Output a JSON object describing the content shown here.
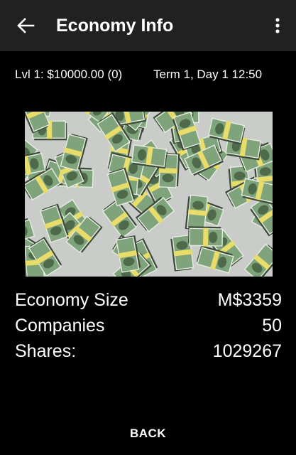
{
  "appbar": {
    "title": "Economy Info"
  },
  "status": {
    "level_balance": "Lvl 1: $10000.00 (0)",
    "term_time": "Term 1, Day 1  12:50"
  },
  "stats": [
    {
      "label": "Economy Size",
      "value": "M$3359"
    },
    {
      "label": "Companies",
      "value": "50"
    },
    {
      "label": "Shares:",
      "value": "1029267"
    }
  ],
  "footer": {
    "back_label": "BACK"
  },
  "icons": {
    "back": "arrow-left-icon",
    "menu": "more-vert-icon"
  },
  "colors": {
    "appbar": "#212121",
    "background": "#000000",
    "text": "#ffffff",
    "bill_green": "#7fa37a",
    "band_yellow": "#e8dc6a"
  }
}
